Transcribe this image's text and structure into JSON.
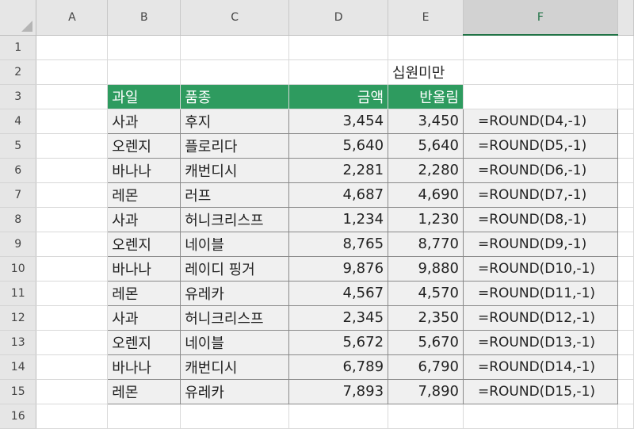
{
  "sheet": {
    "columns": [
      "A",
      "B",
      "C",
      "D",
      "E",
      "F"
    ],
    "rows": [
      "1",
      "2",
      "3",
      "4",
      "5",
      "6",
      "7",
      "8",
      "9",
      "10",
      "11",
      "12",
      "13",
      "14",
      "15",
      "16"
    ],
    "e2_label": "십원미만",
    "header": {
      "b": "과일",
      "c": "품종",
      "d": "금액",
      "e": "반올림"
    },
    "data": [
      {
        "fruit": "사과",
        "variety": "후지",
        "amount": "3,454",
        "rounded": "3,450",
        "formula": "=ROUND(D4,-1)"
      },
      {
        "fruit": "오렌지",
        "variety": "플로리다",
        "amount": "5,640",
        "rounded": "5,640",
        "formula": "=ROUND(D5,-1)"
      },
      {
        "fruit": "바나나",
        "variety": "캐번디시",
        "amount": "2,281",
        "rounded": "2,280",
        "formula": "=ROUND(D6,-1)"
      },
      {
        "fruit": "레몬",
        "variety": "러프",
        "amount": "4,687",
        "rounded": "4,690",
        "formula": "=ROUND(D7,-1)"
      },
      {
        "fruit": "사과",
        "variety": "허니크리스프",
        "amount": "1,234",
        "rounded": "1,230",
        "formula": "=ROUND(D8,-1)"
      },
      {
        "fruit": "오렌지",
        "variety": "네이블",
        "amount": "8,765",
        "rounded": "8,770",
        "formula": "=ROUND(D9,-1)"
      },
      {
        "fruit": "바나나",
        "variety": "레이디 핑거",
        "amount": "9,876",
        "rounded": "9,880",
        "formula": "=ROUND(D10,-1)"
      },
      {
        "fruit": "레몬",
        "variety": "유레카",
        "amount": "4,567",
        "rounded": "4,570",
        "formula": "=ROUND(D11,-1)"
      },
      {
        "fruit": "사과",
        "variety": "허니크리스프",
        "amount": "2,345",
        "rounded": "2,350",
        "formula": "=ROUND(D12,-1)"
      },
      {
        "fruit": "오렌지",
        "variety": "네이블",
        "amount": "5,672",
        "rounded": "5,670",
        "formula": "=ROUND(D13,-1)"
      },
      {
        "fruit": "바나나",
        "variety": "캐번디시",
        "amount": "6,789",
        "rounded": "6,790",
        "formula": "=ROUND(D14,-1)"
      },
      {
        "fruit": "레몬",
        "variety": "유레카",
        "amount": "7,893",
        "rounded": "7,890",
        "formula": "=ROUND(D15,-1)"
      }
    ],
    "colors": {
      "header_fill": "#2e9b5f",
      "header_text": "#ffffff",
      "data_fill": "#f0f0f0",
      "active_column": "#217346"
    },
    "active_column": "F"
  }
}
